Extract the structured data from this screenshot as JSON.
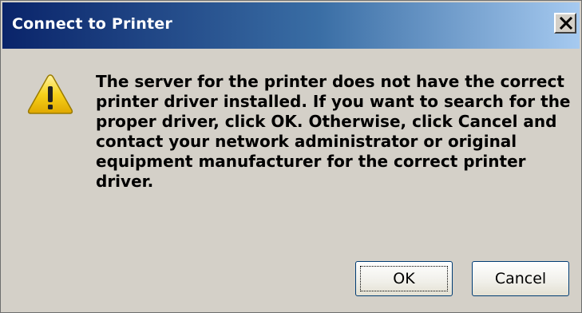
{
  "dialog": {
    "title": "Connect to Printer",
    "close_icon": "close-icon",
    "warning_icon": "warning-icon",
    "message": "The server for the printer does not have the correct printer driver installed.  If you want to search for the proper driver, click OK.  Otherwise, click Cancel and contact your network administrator or original equipment manufacturer for the correct printer driver.",
    "ok_label": "OK",
    "cancel_label": "Cancel"
  },
  "colors": {
    "titlebar_start": "#0a246a",
    "titlebar_end": "#a6caf0",
    "dialog_bg": "#d4d0c8",
    "warning_yellow": "#f5c400"
  }
}
